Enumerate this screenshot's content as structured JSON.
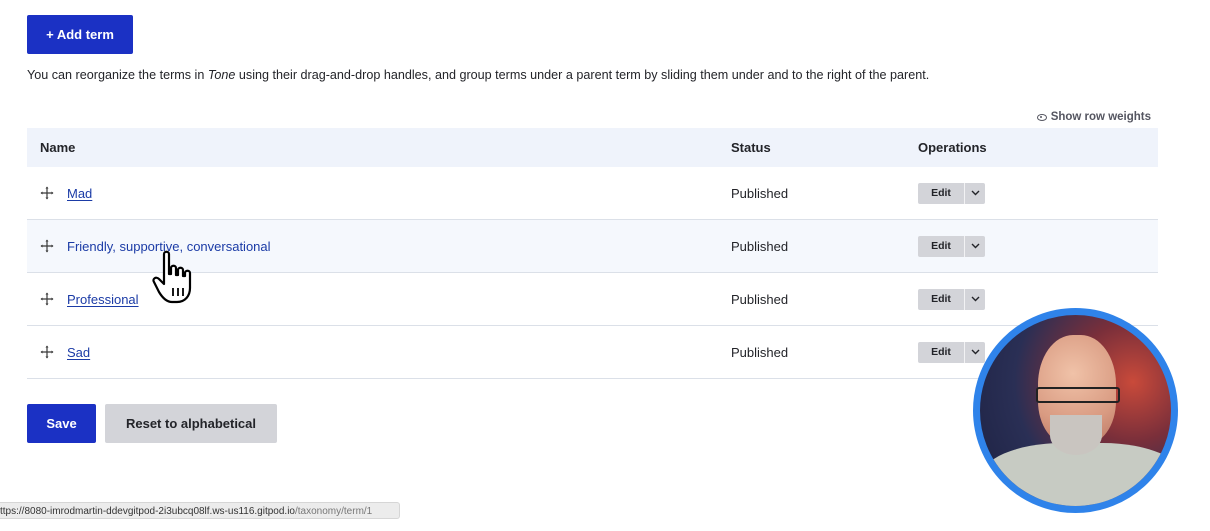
{
  "toolbar": {
    "add_term_label": "+ Add term"
  },
  "help": {
    "before": "You can reorganize the terms in ",
    "vocabulary": "Tone",
    "after": " using their drag-and-drop handles, and group terms under a parent term by sliding them under and to the right of the parent."
  },
  "row_weights": {
    "label": "Show row weights",
    "icon": "eye-icon"
  },
  "table": {
    "headers": {
      "name": "Name",
      "status": "Status",
      "operations": "Operations"
    },
    "rows": [
      {
        "name": "Mad",
        "status": "Published",
        "operation": "Edit",
        "hovered": false
      },
      {
        "name": "Friendly, supportive, conversational",
        "status": "Published",
        "operation": "Edit",
        "hovered": true
      },
      {
        "name": "Professional",
        "status": "Published",
        "operation": "Edit",
        "hovered": false
      },
      {
        "name": "Sad",
        "status": "Published",
        "operation": "Edit",
        "hovered": false
      }
    ]
  },
  "actions": {
    "save_label": "Save",
    "reset_label": "Reset to alphabetical"
  },
  "statusbar": {
    "host": "ttps://8080-imrodmartin-ddevgitpod-2i3ubcq08lf.ws-us116.gitpod.io",
    "path": "/taxonomy/term/1"
  },
  "colors": {
    "primary": "#1b31c4",
    "link": "#1b3ba6",
    "header_bg": "#eff3fb",
    "webcam_ring": "#2f83ea"
  }
}
